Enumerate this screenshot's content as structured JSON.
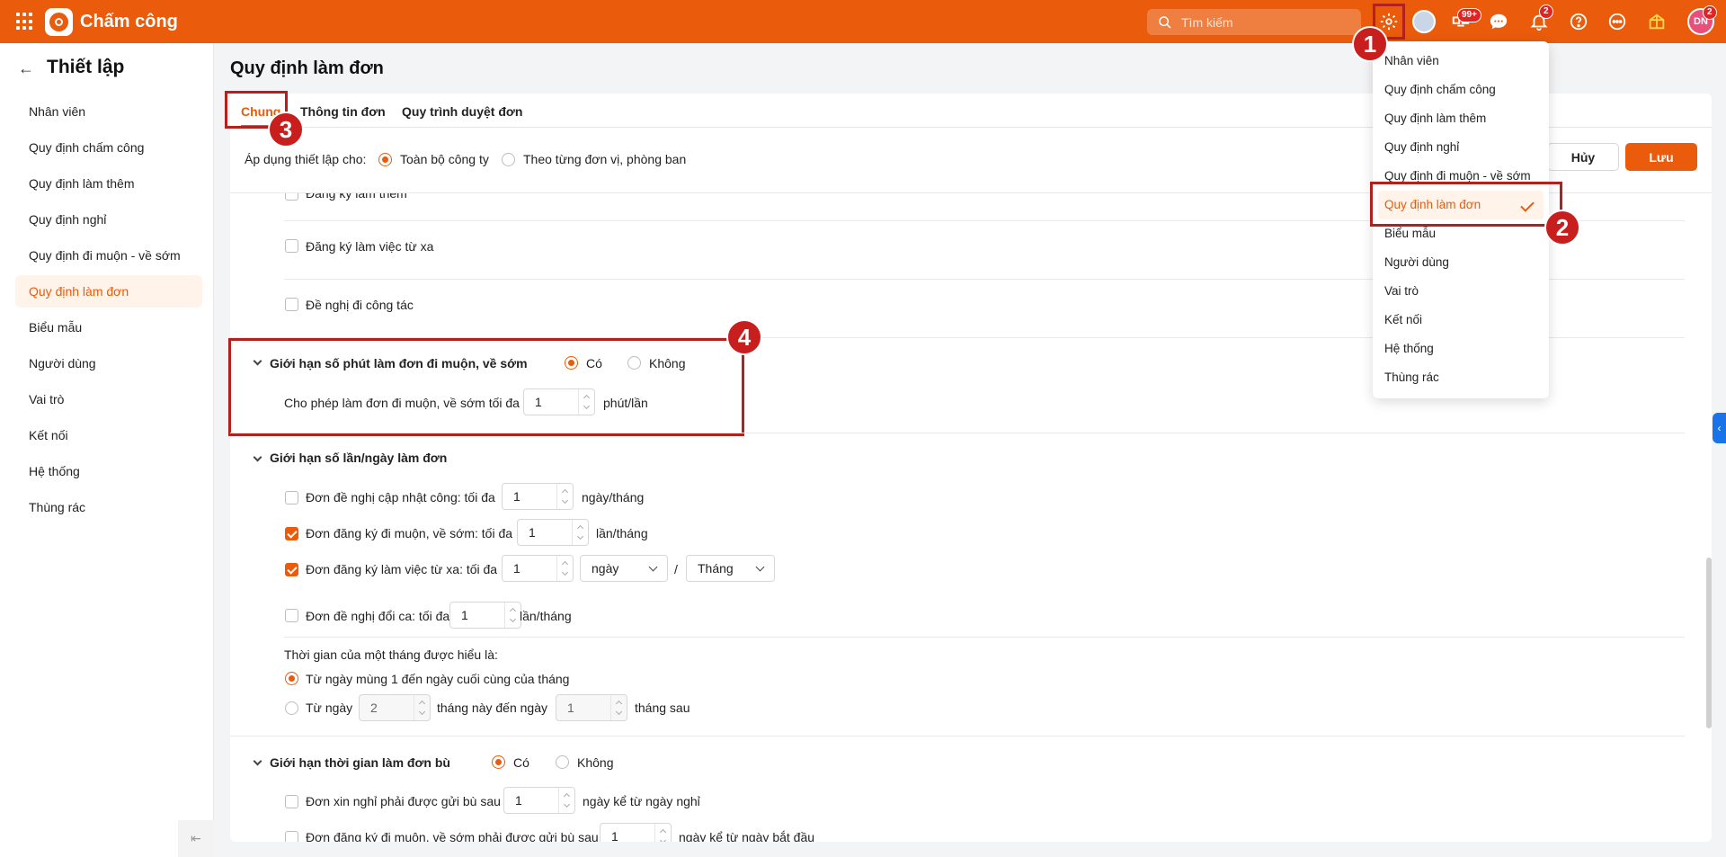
{
  "app": {
    "title": "Chấm công"
  },
  "topbar": {
    "search_placeholder": "Tìm kiếm",
    "apps_badge": "99+",
    "notifications_badge": "2",
    "avatar_initials": "DN",
    "avatar_badge": "2"
  },
  "sidebar": {
    "title": "Thiết lập",
    "items": [
      {
        "label": "Nhân viên"
      },
      {
        "label": "Quy định chấm công"
      },
      {
        "label": "Quy định làm thêm"
      },
      {
        "label": "Quy định nghỉ"
      },
      {
        "label": "Quy định đi muộn - về sớm"
      },
      {
        "label": "Quy định làm đơn"
      },
      {
        "label": "Biểu mẫu"
      },
      {
        "label": "Người dùng"
      },
      {
        "label": "Vai trò"
      },
      {
        "label": "Kết nối"
      },
      {
        "label": "Hệ thống"
      },
      {
        "label": "Thùng rác"
      }
    ],
    "active_index": 5
  },
  "page": {
    "title": "Quy định làm đơn",
    "tabs": [
      {
        "label": "Chung"
      },
      {
        "label": "Thông tin đơn"
      },
      {
        "label": "Quy trình duyệt đơn"
      }
    ],
    "apply": {
      "label": "Áp dụng thiết lập cho:",
      "option_all": "Toàn bộ công ty",
      "option_unit": "Theo từng đơn vị, phòng ban"
    },
    "buttons": {
      "cancel": "Hủy",
      "save": "Lưu"
    },
    "form_types": [
      {
        "label": "Đăng ký làm thêm"
      },
      {
        "label": "Đăng ký làm việc từ xa"
      },
      {
        "label": "Đề nghị đi công tác"
      }
    ],
    "late_limit": {
      "title": "Giới hạn số phút làm đơn đi muộn, về sớm",
      "yes": "Có",
      "no": "Không",
      "allow_label": "Cho phép làm đơn đi muộn, về sớm tối đa",
      "value": "1",
      "unit": "phút/lần"
    },
    "count_limit": {
      "title": "Giới hạn số lần/ngày làm đơn",
      "rows": [
        {
          "label": "Đơn đề nghị cập nhật công: tối đa",
          "value": "1",
          "unit": "ngày/tháng"
        },
        {
          "label": "Đơn đăng ký đi muộn, về sớm: tối đa",
          "value": "1",
          "unit": "lần/tháng"
        },
        {
          "label": "Đơn đăng ký làm việc từ xa: tối đa",
          "value": "1",
          "unit_select": "ngày",
          "slash": "/",
          "period_select": "Tháng"
        },
        {
          "label": "Đơn đề nghị đổi ca: tối đa",
          "value": "1",
          "unit": "lần/tháng"
        }
      ],
      "month_def_label": "Thời gian của một tháng được hiểu là:",
      "month_opt1": "Từ ngày mùng 1 đến ngày cuối cùng của tháng",
      "month_opt2_prefix": "Từ ngày",
      "month_opt2_from": "2",
      "month_opt2_mid": "tháng này đến ngày",
      "month_opt2_to": "1",
      "month_opt2_suffix": "tháng sau"
    },
    "backfill_limit": {
      "title": "Giới hạn thời gian làm đơn bù",
      "yes": "Có",
      "no": "Không",
      "row1_label": "Đơn xin nghỉ phải được gửi bù sau",
      "row1_value": "1",
      "row1_unit": "ngày kể từ ngày nghỉ",
      "row2_label": "Đơn đăng ký đi muộn, về sớm phải được gửi bù sau",
      "row2_value": "1",
      "row2_unit": "ngày kể từ ngày bắt đầu"
    }
  },
  "settings_menu": {
    "items": [
      {
        "label": "Nhân viên"
      },
      {
        "label": "Quy định chấm công"
      },
      {
        "label": "Quy định làm thêm"
      },
      {
        "label": "Quy định nghỉ"
      },
      {
        "label": "Quy định đi muộn - về sớm"
      },
      {
        "label": "Quy định làm đơn"
      },
      {
        "label": "Biểu mẫu"
      },
      {
        "label": "Người dùng"
      },
      {
        "label": "Vai trò"
      },
      {
        "label": "Kết nối"
      },
      {
        "label": "Hệ thống"
      },
      {
        "label": "Thùng rác"
      }
    ],
    "active_index": 5
  },
  "annotations": {
    "m1": "1",
    "m2": "2",
    "m3": "3",
    "m4": "4"
  },
  "colors": {
    "accent": "#ea5b0c",
    "highlight_box": "#b3211f",
    "marker": "#c81e1e"
  }
}
